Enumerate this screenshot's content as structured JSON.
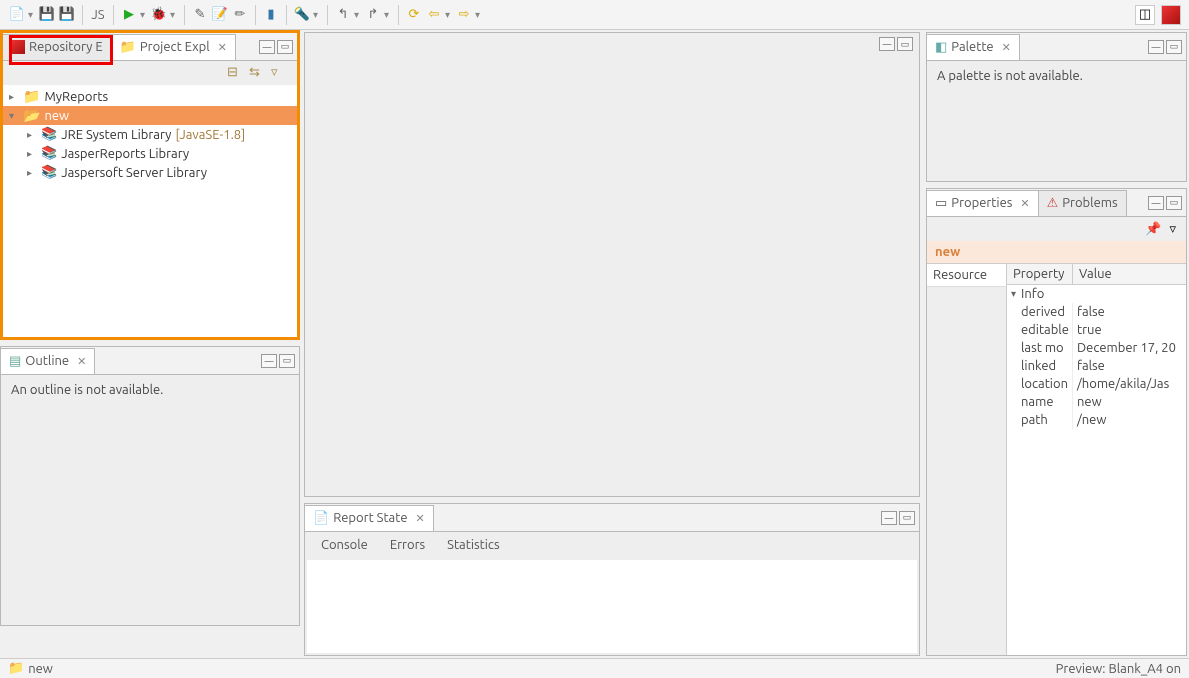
{
  "toolbar": {
    "navNext": "⇨",
    "navPrev": "⇦"
  },
  "leftPanel": {
    "tabs": [
      {
        "label": "Repository E"
      },
      {
        "label": "Project Expl"
      }
    ],
    "tree": [
      {
        "label": "MyReports",
        "type": "folder"
      },
      {
        "label": "new",
        "type": "folder-selected"
      },
      {
        "label": "JRE System Library",
        "suffix": "[JavaSE-1.8]",
        "type": "lib"
      },
      {
        "label": "JasperReports Library",
        "type": "lib"
      },
      {
        "label": "Jaspersoft Server Library",
        "type": "lib"
      }
    ]
  },
  "outline": {
    "title": "Outline",
    "message": "An outline is not available."
  },
  "palette": {
    "title": "Palette",
    "message": "A palette is not available."
  },
  "reportState": {
    "title": "Report State",
    "subtabs": [
      "Console",
      "Errors",
      "Statistics"
    ]
  },
  "properties": {
    "tabs": [
      "Properties",
      "Problems"
    ],
    "selected": "new",
    "side": [
      "Resource"
    ],
    "columns": {
      "property": "Property",
      "value": "Value"
    },
    "group": "Info",
    "rows": [
      {
        "p": "derived",
        "v": "false"
      },
      {
        "p": "editable",
        "v": "true"
      },
      {
        "p": "last mo",
        "v": "December 17, 20"
      },
      {
        "p": "linked",
        "v": "false"
      },
      {
        "p": "location",
        "v": "/home/akila/Jas"
      },
      {
        "p": "name",
        "v": "new"
      },
      {
        "p": "path",
        "v": "/new"
      }
    ]
  },
  "status": {
    "left": "new",
    "right": "Preview: Blank_A4 on"
  }
}
